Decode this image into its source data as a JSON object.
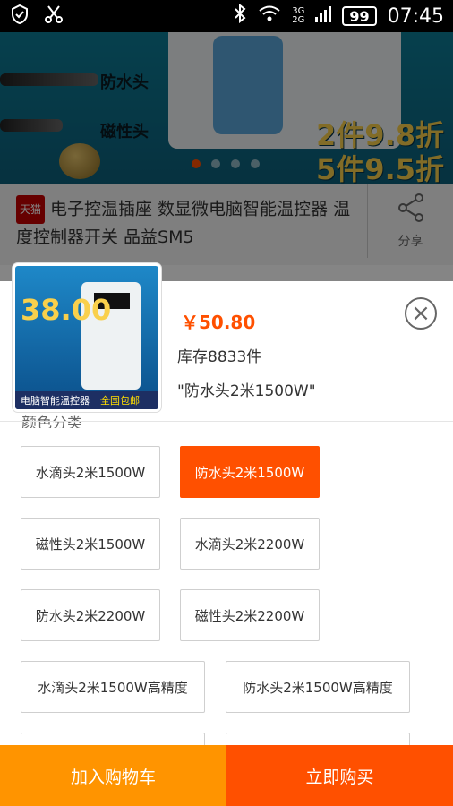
{
  "status_bar": {
    "time": "07:45",
    "battery": "99",
    "network_top": "3G",
    "network_bottom": "2G",
    "icons": [
      "shield-icon",
      "scissors-icon",
      "bluetooth-icon",
      "wifi-icon",
      "signal-icon"
    ]
  },
  "banner": {
    "label_waterproof": "防水头",
    "label_magnetic": "磁性头",
    "promo_1": "2件9.8折",
    "promo_2": "5件9.5折",
    "dots": 4,
    "active_dot": 0
  },
  "product": {
    "store_badge": "天猫",
    "title": "电子控温插座 数显微电脑智能温控器 温度控制器开关 品益SM5",
    "share_label": "分享"
  },
  "sku_panel": {
    "thumb_price": "38.00",
    "thumb_strip": "电脑智能温控器",
    "thumb_strip_highlight": "全国包邮",
    "price": "￥50.80",
    "stock": "库存8833件",
    "selected": "\"防水头2米1500W\"",
    "group_title": "颜色分类",
    "options": [
      {
        "label": "水滴头2米1500W",
        "active": false
      },
      {
        "label": "防水头2米1500W",
        "active": true
      },
      {
        "label": "磁性头2米1500W",
        "active": false
      },
      {
        "label": "水滴头2米2200W",
        "active": false
      },
      {
        "label": "防水头2米2200W",
        "active": false
      },
      {
        "label": "磁性头2米2200W",
        "active": false
      },
      {
        "label": "水滴头2米1500W高精度",
        "active": false
      },
      {
        "label": "防水头2米1500W高精度",
        "active": false
      }
    ]
  },
  "actions": {
    "add_to_cart": "加入购物车",
    "buy_now": "立即购买"
  },
  "colors": {
    "accent": "#ff5000",
    "cart": "#ff9400"
  }
}
